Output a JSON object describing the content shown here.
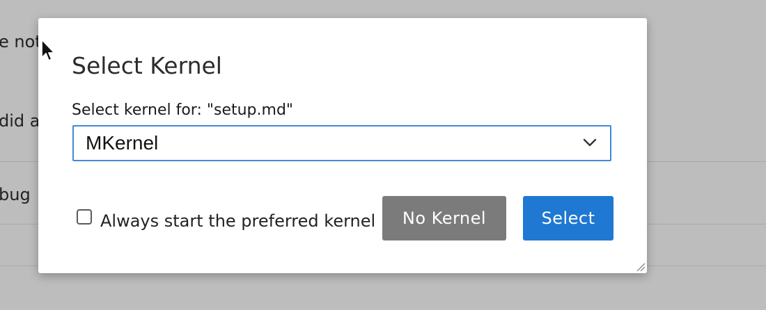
{
  "background": {
    "line1": "e not",
    "line2": "did a",
    "line3": "bug"
  },
  "dialog": {
    "title": "Select Kernel",
    "select_label": "Select kernel for: \"setup.md\"",
    "select_value": "MKernel",
    "checkbox_label": "Always start the preferred kernel",
    "checkbox_checked": false,
    "no_kernel_label": "No Kernel",
    "select_button_label": "Select"
  },
  "icons": {
    "dropdown": "chevron-down-icon",
    "resize": "resize-grip-icon",
    "pointer": "mouse-pointer-icon"
  },
  "colors": {
    "accent": "#1f78d1",
    "secondary_button": "#7b7b7b",
    "focus_border": "#3f8ad6",
    "backdrop": "#bdbdbd"
  }
}
